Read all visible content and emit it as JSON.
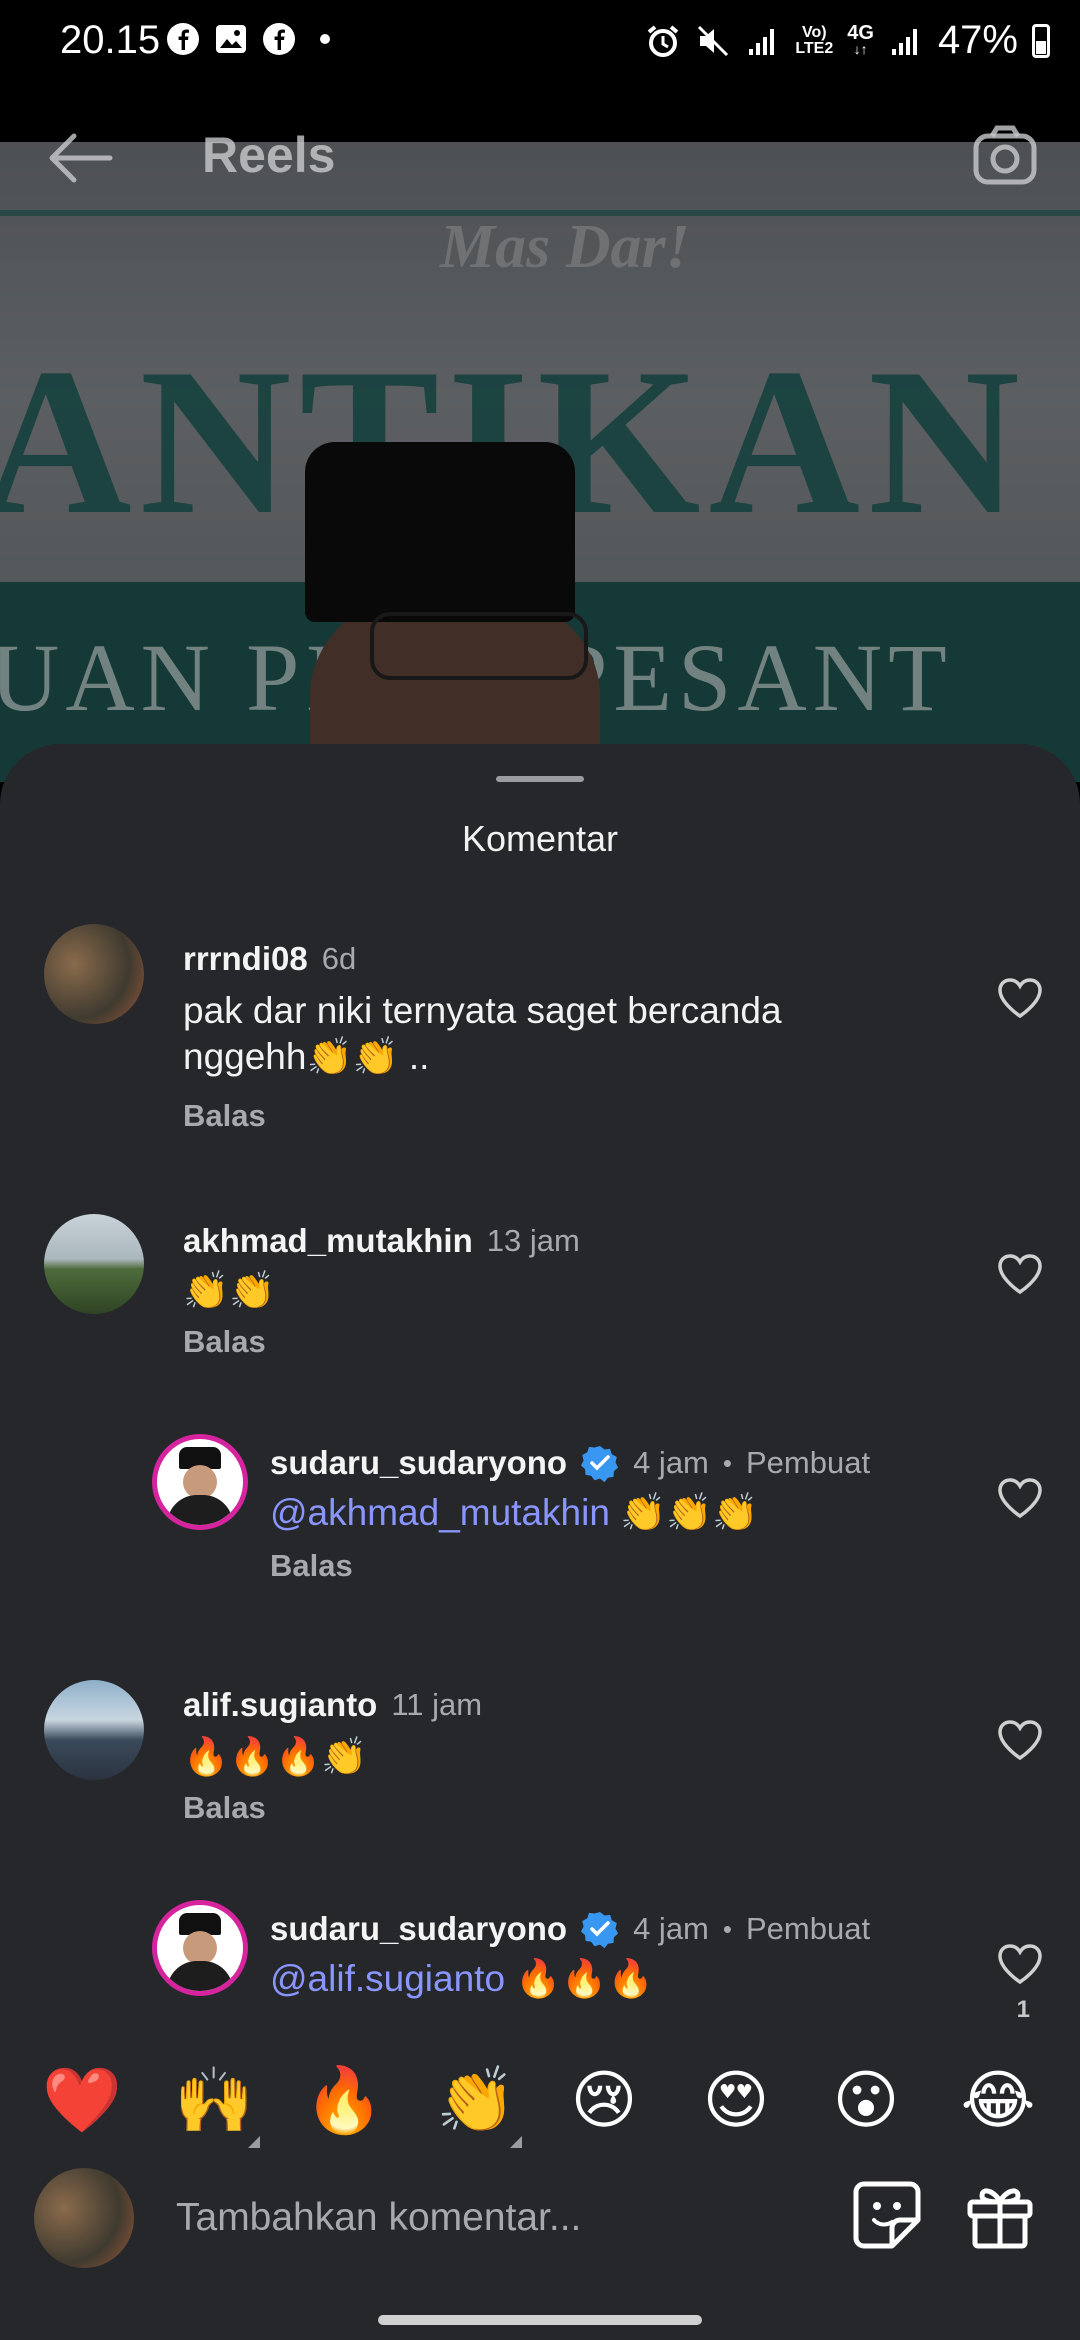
{
  "status_bar": {
    "time": "20.15",
    "network_line1": "Vo)",
    "network_line2": "LTE2",
    "network_type": "4G",
    "battery": "47%"
  },
  "header": {
    "title": "Reels"
  },
  "video_scene": {
    "brand": "Mas Dar!",
    "banner_main": "ANTIKAN",
    "banner_sub": "UAN PI    UH PESANT"
  },
  "sheet": {
    "title": "Komentar"
  },
  "comments": [
    {
      "username": "rrrndi08",
      "time": "6d",
      "text": "pak dar niki ternyata saget bercanda nggehh👏👏 ..",
      "reply_label": "Balas"
    },
    {
      "username": "akhmad_mutakhin",
      "time": "13 jam",
      "text": "👏👏",
      "reply_label": "Balas"
    },
    {
      "username": "sudaru_sudaryono",
      "time": "4 jam",
      "creator_label": "Pembuat",
      "mention": "@akhmad_mutakhin",
      "text": " 👏👏👏",
      "reply_label": "Balas"
    },
    {
      "username": "alif.sugianto",
      "time": "11 jam",
      "text": "🔥🔥🔥👏",
      "reply_label": "Balas"
    },
    {
      "username": "sudaru_sudaryono",
      "time": "4 jam",
      "creator_label": "Pembuat",
      "mention": "@alif.sugianto",
      "text": " 🔥🔥🔥",
      "likes": "1"
    }
  ],
  "emoji_bar": [
    "❤️",
    "🙌",
    "🔥",
    "👏",
    "😢",
    "😍",
    "😮",
    "😂"
  ],
  "input": {
    "placeholder": "Tambahkan komentar..."
  },
  "icons": {
    "back": "back-arrow-icon",
    "camera": "camera-icon",
    "heart": "heart-outline-icon",
    "verified": "verified-badge-icon",
    "sticker": "sticker-icon",
    "gift": "gift-icon"
  },
  "colors": {
    "sheet_bg": "#25272b",
    "mention": "#8a96ff",
    "verified": "#3897f0",
    "secondary_text": "#a8a9ad"
  }
}
